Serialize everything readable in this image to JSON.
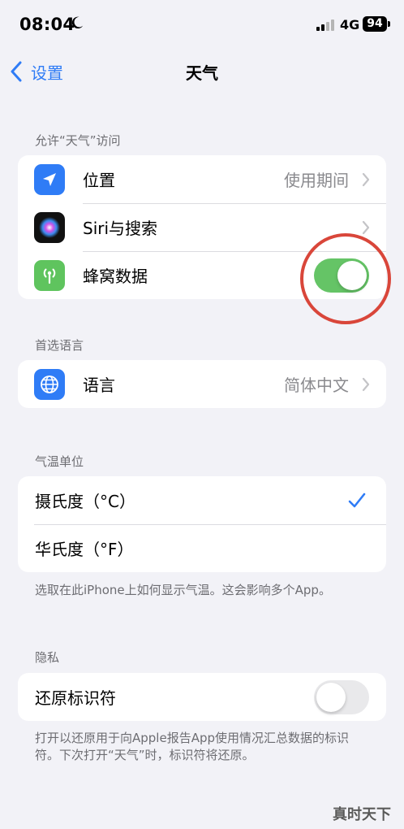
{
  "status_bar": {
    "time": "08:04",
    "network": "4G",
    "battery": "94"
  },
  "nav": {
    "back_label": "设置",
    "title": "天气"
  },
  "access": {
    "header": "允许“天气”访问",
    "location": {
      "label": "位置",
      "value": "使用期间"
    },
    "siri": {
      "label": "Siri与搜索"
    },
    "cellular": {
      "label": "蜂窝数据",
      "enabled": true
    }
  },
  "language": {
    "header": "首选语言",
    "row": {
      "label": "语言",
      "value": "简体中文"
    }
  },
  "temperature": {
    "header": "气温单位",
    "celsius_label": "摄氏度（°C）",
    "fahrenheit_label": "华氏度（°F）",
    "selected": "celsius",
    "footer": "选取在此iPhone上如何显示气温。这会影响多个App。"
  },
  "privacy": {
    "header": "隐私",
    "reset_label": "还原标识符",
    "reset_enabled": false,
    "footer": "打开以还原用于向Apple报告App使用情况汇总数据的标识符。下次打开“天气”时，标识符将还原。"
  },
  "watermark": "真时天下",
  "colors": {
    "accent": "#2f7cf6",
    "toggle_on": "#65c466",
    "annotation": "#d9463a"
  }
}
